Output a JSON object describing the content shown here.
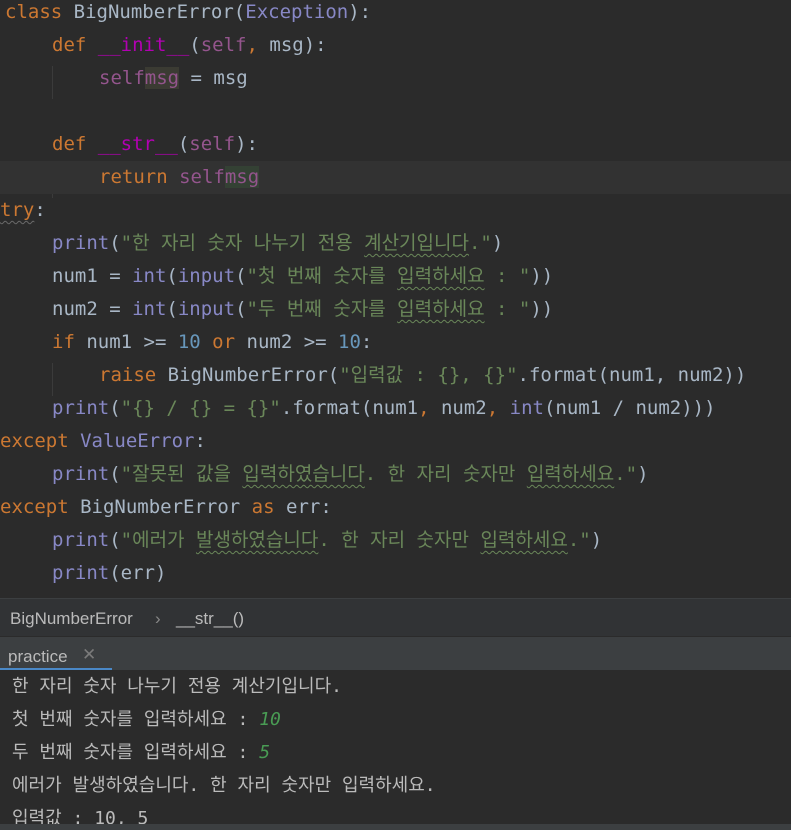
{
  "editor": {
    "lines": {
      "l1": {
        "a": "class ",
        "b": "BigNumberError",
        "c": "(",
        "d": "Exception",
        "e": "):"
      },
      "l2": {
        "a": "def ",
        "b": "__init__",
        "c": "(",
        "d": "self",
        ",": ", ",
        "e": "msg",
        "f": "):"
      },
      "l3": {
        "a": "self",
        ".": ".",
        "b": "msg",
        "c": " = msg"
      },
      "l5": {
        "a": "def ",
        "b": "__str__",
        "c": "(",
        "d": "self",
        "e": "):"
      },
      "l6": {
        "a": "return ",
        "b": "self",
        ".": ".",
        "c": "msg"
      },
      "l7": {
        "a": "try",
        ":": ":"
      },
      "l8": {
        "a": "print",
        "b": "(",
        "c": "\"한 자리 숫자 나누기 전용 ",
        "d": "계산기입니다",
        "e": ".\"",
        "f": ")"
      },
      "l9": {
        "a": "num1 = ",
        "b": "int",
        "c": "(",
        "d": "input",
        "e": "(",
        "f": "\"첫 번째 숫자를 ",
        "g": "입력하세요",
        "h": " : \"",
        "i": "))"
      },
      "l10": {
        "a": "num2 = ",
        "b": "int",
        "c": "(",
        "d": "input",
        "e": "(",
        "f": "\"두 번째 숫자를 ",
        "g": "입력하세요",
        "h": " : \"",
        "i": "))"
      },
      "l11": {
        "a": "if ",
        "b": "num1 >= ",
        "c": "10",
        "d": " or ",
        "e": "num2 >= ",
        "f": "10",
        ":": ":"
      },
      "l12": {
        "a": "raise ",
        "b": "BigNumberError(",
        "c": "\"입력값 : {}, {}\"",
        "d": ".format(num1, num2))"
      },
      "l13": {
        "a": "print",
        "b": "(",
        "c": "\"{} / {} = {}\"",
        "d": ".format(num1",
        ",": ", ",
        "e": "num2",
        ",2": ", ",
        "f": "int",
        "g": "(num1 / num2)))"
      },
      "l14": {
        "a": "except ",
        "b": "ValueError",
        ":": ":"
      },
      "l15": {
        "a": "print",
        "b": "(",
        "c": "\"잘못된 값을 ",
        "d": "입력하였습니다",
        "e": ". 한 자리 숫자만 ",
        "f": "입력하세요",
        "g": ".\"",
        "h": ")"
      },
      "l16": {
        "a": "except ",
        "b": "BigNumberError ",
        "c": "as ",
        "d": "err:"
      },
      "l17": {
        "a": "print",
        "b": "(",
        "c": "\"에러가 ",
        "d": "발생하였습니다",
        "e": ". 한 자리 숫자만 ",
        "f": "입력하세요",
        "g": ".\"",
        "h": ")"
      },
      "l18": {
        "a": "print",
        "b": "(err)"
      }
    }
  },
  "breadcrumb": {
    "class_name": "BigNumberError",
    "separator": "›",
    "method": "__str__()"
  },
  "run_tab": {
    "label": "practice",
    "close": "✕"
  },
  "console": {
    "lines": [
      "한 자리 숫자 나누기 전용 계산기입니다.",
      "첫 번째 숫자를 입력하세요 : ",
      "두 번째 숫자를 입력하세요 : ",
      "에러가 발생하였습니다. 한 자리 숫자만 입력하세요.",
      "입력값 : 10, 5"
    ],
    "input1": "10",
    "input2": "5"
  },
  "colors": {
    "background": "#2b2b2b",
    "keyword": "#cc7832",
    "string": "#6a8759",
    "number": "#6897bb",
    "function": "#ffc66d",
    "accent": "#4a88c7"
  }
}
